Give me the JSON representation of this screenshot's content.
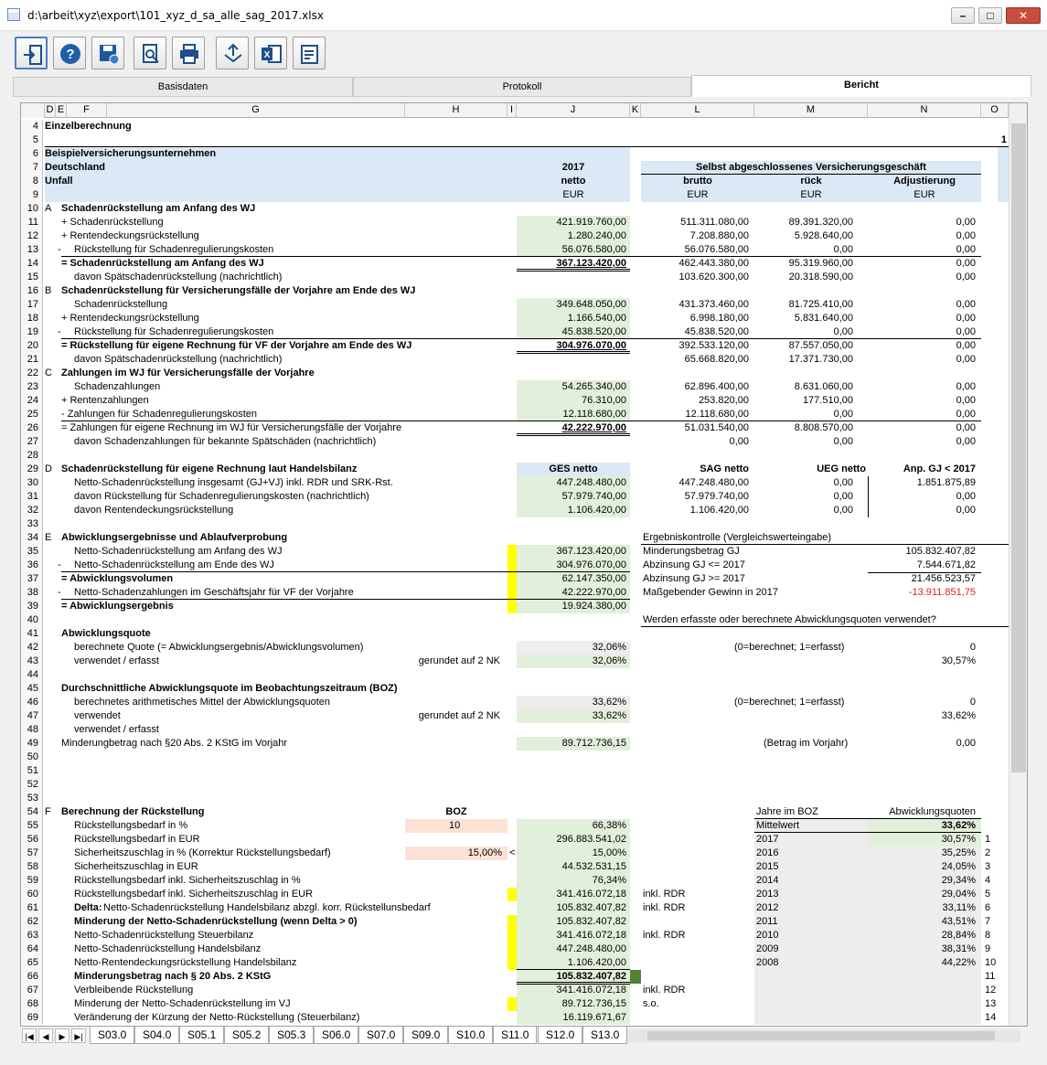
{
  "window": {
    "title": "d:\\arbeit\\xyz\\export\\101_xyz_d_sa_alle_sag_2017.xlsx"
  },
  "tabs": [
    "Basisdaten",
    "Protokoll",
    "Bericht"
  ],
  "columns": [
    "D",
    "E",
    "F",
    "G",
    "H",
    "I",
    "J",
    "K",
    "L",
    "M",
    "N",
    "O"
  ],
  "sheet_tabs": [
    "S03.0",
    "S04.0",
    "S05.1",
    "S05.2",
    "S05.3",
    "S06.0",
    "S07.0",
    "S09.0",
    "S10.0",
    "S11.0",
    "S12.0",
    "S13.0"
  ],
  "row_numbers": [
    "4",
    "5",
    "6",
    "7",
    "8",
    "9",
    "10",
    "11",
    "12",
    "13",
    "14",
    "15",
    "16",
    "17",
    "18",
    "19",
    "20",
    "21",
    "22",
    "23",
    "24",
    "25",
    "26",
    "27",
    "28",
    "29",
    "30",
    "31",
    "32",
    "33",
    "34",
    "35",
    "36",
    "37",
    "38",
    "39",
    "40",
    "41",
    "42",
    "43",
    "44",
    "45",
    "46",
    "47",
    "48",
    "49",
    "50",
    "51",
    "52",
    "53",
    "54",
    "55",
    "56",
    "57",
    "58",
    "59",
    "60",
    "61",
    "62",
    "63",
    "64",
    "65",
    "66",
    "67",
    "68",
    "69"
  ],
  "header": {
    "einzel": "Einzelberechnung",
    "edge_1": "1",
    "company": "Beispielversicherungsunternehmen",
    "country": "Deutschland",
    "line": "Unfall",
    "year": "2017",
    "netto": "netto",
    "eur": "EUR",
    "sag_title": "Selbst abgeschlossenes Versicherungsgeschäft",
    "brutto": "brutto",
    "rueck": "rück",
    "adjust": "Adjustierung"
  },
  "secA": {
    "letter": "A",
    "title": "Schadenrückstellung am Anfang des WJ",
    "r11": {
      "label": "+ Schadenrückstellung",
      "j": "421.919.760,00",
      "l": "511.311.080,00",
      "m": "89.391.320,00",
      "n": "0,00"
    },
    "r12": {
      "label": "+ Rentendeckungsrückstellung",
      "j": "1.280.240,00",
      "l": "7.208.880,00",
      "m": "5.928.640,00",
      "n": "0,00"
    },
    "r13": {
      "sign": "-",
      "label": "Rückstellung für Schadenregulierungskosten",
      "j": "56.076.580,00",
      "l": "56.076.580,00",
      "m": "0,00",
      "n": "0,00"
    },
    "r14": {
      "label": "= Schadenrückstellung am Anfang des WJ",
      "j": "367.123.420,00",
      "l": "462.443.380,00",
      "m": "95.319.960,00",
      "n": "0,00"
    },
    "r15": {
      "label": "davon Spätschadenrückstellung (nachrichtlich)",
      "l": "103.620.300,00",
      "m": "20.318.590,00",
      "n": "0,00"
    }
  },
  "secB": {
    "letter": "B",
    "title": "Schadenrückstellung für Versicherungsfälle der Vorjahre am Ende des WJ",
    "r17": {
      "label": "Schadenrückstellung",
      "j": "349.648.050,00",
      "l": "431.373.460,00",
      "m": "81.725.410,00",
      "n": "0,00"
    },
    "r18": {
      "label": "+ Rentendeckungsrückstellung",
      "j": "1.166.540,00",
      "l": "6.998.180,00",
      "m": "5.831.640,00",
      "n": "0,00"
    },
    "r19": {
      "sign": "-",
      "label": "Rückstellung für Schadenregulierungskosten",
      "j": "45.838.520,00",
      "l": "45.838.520,00",
      "m": "0,00",
      "n": "0,00"
    },
    "r20": {
      "label": "= Rückstellung für eigene Rechnung für VF der Vorjahre am Ende des WJ",
      "j": "304.976.070,00",
      "l": "392.533.120,00",
      "m": "87.557.050,00",
      "n": "0,00"
    },
    "r21": {
      "label": "davon Spätschadenrückstellung (nachrichtlich)",
      "l": "65.668.820,00",
      "m": "17.371.730,00",
      "n": "0,00"
    }
  },
  "secC": {
    "letter": "C",
    "title": "Zahlungen im WJ für Versicherungsfälle der Vorjahre",
    "r23": {
      "label": "Schadenzahlungen",
      "j": "54.265.340,00",
      "l": "62.896.400,00",
      "m": "8.631.060,00",
      "n": "0,00"
    },
    "r24": {
      "label": "+ Rentenzahlungen",
      "j": "76.310,00",
      "l": "253.820,00",
      "m": "177.510,00",
      "n": "0,00"
    },
    "r25": {
      "label": "- Zahlungen für Schadenregulierungskosten",
      "j": "12.118.680,00",
      "l": "12.118.680,00",
      "m": "0,00",
      "n": "0,00"
    },
    "r26": {
      "label": "= Zahlungen für eigene Rechnung im WJ für Versicherungsfälle der Vorjahre",
      "j": "42.222.970,00",
      "l": "51.031.540,00",
      "m": "8.808.570,00",
      "n": "0,00"
    },
    "r27": {
      "label": "davon Schadenzahlungen für bekannte Spätschäden (nachrichtlich)",
      "l": "0,00",
      "m": "0,00",
      "n": "0,00"
    }
  },
  "secD": {
    "letter": "D",
    "title": "Schadenrückstellung für eigene Rechnung laut Handelsbilanz",
    "h_j": "GES netto",
    "h_l": "SAG netto",
    "h_m": "UEG netto",
    "h_n": "Anp. GJ < 2017",
    "r30": {
      "label": "Netto-Schadenrückstellung insgesamt (GJ+VJ) inkl. RDR und SRK-Rst.",
      "j": "447.248.480,00",
      "l": "447.248.480,00",
      "m": "0,00",
      "n": "1.851.875,89"
    },
    "r31": {
      "label": "davon Rückstellung für Schadenregulierungskosten (nachrichtlich)",
      "j": "57.979.740,00",
      "l": "57.979.740,00",
      "m": "0,00",
      "n": "0,00"
    },
    "r32": {
      "label": "davon Rentendeckungsrückstellung",
      "j": "1.106.420,00",
      "l": "1.106.420,00",
      "m": "0,00",
      "n": "0,00"
    }
  },
  "secE": {
    "letter": "E",
    "title": "Abwicklungsergebnisse und Ablaufverprobung",
    "r35": {
      "label": "Netto-Schadenrückstellung am Anfang des WJ",
      "j": "367.123.420,00"
    },
    "r36": {
      "sign": "-",
      "label": "Netto-Schadenrückstellung am Ende des WJ",
      "j": "304.976.070,00"
    },
    "r37": {
      "label": "= Abwicklungsvolumen",
      "j": "62.147.350,00"
    },
    "r38": {
      "sign": "-",
      "label": "Netto-Schadenzahlungen im Geschäftsjahr für VF der Vorjahre",
      "j": "42.222.970,00"
    },
    "r39": {
      "label": "= Abwicklungsergebnis",
      "j": "19.924.380,00"
    },
    "ek_title": "Ergebniskontrolle (Vergleichswerteingabe)",
    "ek": [
      {
        "label": "Minderungsbetrag GJ",
        "val": "105.832.407,82"
      },
      {
        "label": "Abzinsung GJ <= 2017",
        "val": "7.544.671,82"
      },
      {
        "label": "Abzinsung GJ >= 2017",
        "val": "21.456.523,57"
      },
      {
        "label": "Maßgebender Gewinn in 2017",
        "val": "-13.911.851,75"
      }
    ],
    "question": "Werden erfasste oder berechnete Abwicklungsquoten verwendet?",
    "q41": "Abwicklungsquote",
    "r42": {
      "label": "berechnete Quote (= Abwicklungsergebnis/Abwicklungsvolumen)",
      "j": "32,06%",
      "hint": "(0=berechnet; 1=erfasst)",
      "n": "0"
    },
    "r43": {
      "label": "verwendet / erfasst",
      "h": "gerundet auf 2 NK",
      "j": "32,06%",
      "n": "30,57%"
    },
    "q45": "Durchschnittliche Abwicklungsquote im Beobachtungszeitraum (BOZ)",
    "r46": {
      "label": "berechnetes arithmetisches Mittel der Abwicklungsquoten",
      "j": "33,62%",
      "hint": "(0=berechnet; 1=erfasst)",
      "n": "0"
    },
    "r47": {
      "label": "verwendet",
      "h": "gerundet auf 2 NK",
      "j": "33,62%",
      "n": "33,62%"
    },
    "r48": {
      "label": "verwendet / erfasst"
    },
    "r49": {
      "label": "Minderungbetrag nach §20 Abs. 2 KStG im Vorjahr",
      "j": "89.712.736,15",
      "hint": "(Betrag im Vorjahr)",
      "n": "0,00"
    }
  },
  "secF": {
    "letter": "F",
    "title": "Berechnung der Rückstellung",
    "boz": "BOZ",
    "rows": [
      {
        "label": "Rückstellungsbedarf in %",
        "h": "10",
        "j": "66,38%"
      },
      {
        "label": "Rückstellungsbedarf in EUR",
        "j": "296.883.541,02"
      },
      {
        "label": "Sicherheitszuschlag in % (Korrektur Rückstellungsbedarf)",
        "h": "15,00%",
        "i": "<",
        "j": "15,00%"
      },
      {
        "label": "Sicherheitszuschlag in EUR",
        "j": "44.532.531,15"
      },
      {
        "label": "Rückstellungsbedarf inkl. Sicherheitszuschlag in %",
        "j": "76,34%"
      },
      {
        "label": "Rückstellungsbedarf inkl. Sicherheitszuschlag in EUR",
        "j": "341.416.072,18",
        "l": "inkl. RDR"
      },
      {
        "label": "Netto-Schadenrückstellung Handelsbilanz abzgl. korr. Rückstellunsbedarf",
        "bold_prefix": "Delta:",
        "j": "105.832.407,82",
        "l": "inkl. RDR"
      },
      {
        "label": "Minderung der Netto-Schadenrückstellung (wenn Delta > 0)",
        "j": "105.832.407,82"
      },
      {
        "label": "Netto-Schadenrückstellung Steuerbilanz",
        "j": "341.416.072,18",
        "l": "inkl. RDR"
      },
      {
        "label": "Netto-Schadenrückstellung Handelsbilanz",
        "j": "447.248.480,00"
      },
      {
        "label": "Netto-Rentendeckungsrückstellung Handelsbilanz",
        "j": "1.106.420,00"
      },
      {
        "label": "Minderungsbetrag nach § 20 Abs. 2 KStG",
        "j": "105.832.407,82"
      },
      {
        "label": "Verbleibende Rückstellung",
        "j": "341.416.072,18",
        "l": "inkl. RDR"
      },
      {
        "label": "Minderung der Netto-Schadenrückstellung im VJ",
        "j": "89.712.736,15",
        "l": "s.o."
      },
      {
        "label": "Veränderung der Kürzung der Netto-Rückstellung (Steuerbilanz)",
        "j": "16.119.671,67"
      }
    ],
    "boz_h_year": "Jahre im BOZ",
    "boz_h_quote": "Abwicklungsquoten",
    "mittelwert": "Mittelwert",
    "mittelwert_val": "33,62%",
    "years": [
      {
        "y": "2017",
        "q": "30,57%",
        "n": "1"
      },
      {
        "y": "2016",
        "q": "35,25%",
        "n": "2"
      },
      {
        "y": "2015",
        "q": "24,05%",
        "n": "3"
      },
      {
        "y": "2014",
        "q": "29,34%",
        "n": "4"
      },
      {
        "y": "2013",
        "q": "29,04%",
        "n": "5"
      },
      {
        "y": "2012",
        "q": "33,11%",
        "n": "6"
      },
      {
        "y": "2011",
        "q": "43,51%",
        "n": "7"
      },
      {
        "y": "2010",
        "q": "28,84%",
        "n": "8"
      },
      {
        "y": "2009",
        "q": "38,31%",
        "n": "9"
      },
      {
        "y": "2008",
        "q": "44,22%",
        "n": "10"
      },
      {
        "y": "",
        "q": "",
        "n": "11"
      },
      {
        "y": "",
        "q": "",
        "n": "12"
      },
      {
        "y": "",
        "q": "",
        "n": "13"
      },
      {
        "y": "",
        "q": "",
        "n": "14"
      }
    ]
  }
}
